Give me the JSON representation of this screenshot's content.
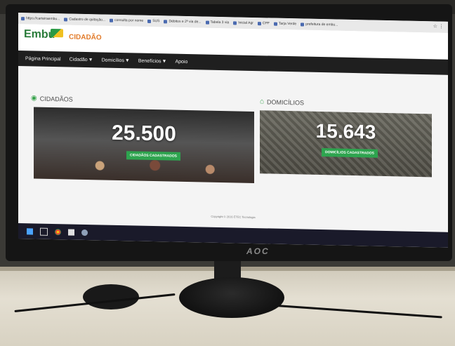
{
  "browser": {
    "bookmarks": [
      "https://carteiraembu...",
      "Cadastro de quitação...",
      "consulta por nome",
      "SUS",
      "Débitos e 2ª via de...",
      "Tabela 3 via",
      "Inicial Agr",
      "CPF",
      "Tarja Verde",
      "prefeitura de embu..."
    ]
  },
  "site": {
    "logo_text": "Embu",
    "logo_sub": "CIDADÃO",
    "nav": [
      "Página Principal",
      "Cidadão",
      "Domicílios",
      "Benefícios",
      "Apoio"
    ]
  },
  "sections": {
    "citizens": {
      "title": "CIDADÃOS",
      "value": "25.500",
      "badge": "CIDADÃOS CADASTRADOS"
    },
    "households": {
      "title": "DOMICÍLIOS",
      "value": "15.643",
      "badge": "DOMICÍLIOS CADASTRADOS"
    }
  },
  "footer": {
    "text": "Copyright © 2016 ETEC Tecnologia"
  },
  "monitor": {
    "brand": "AOC"
  },
  "colors": {
    "accent": "#2ea44f",
    "nav_bg": "#1f1f1f",
    "caret": "#f0c020"
  }
}
